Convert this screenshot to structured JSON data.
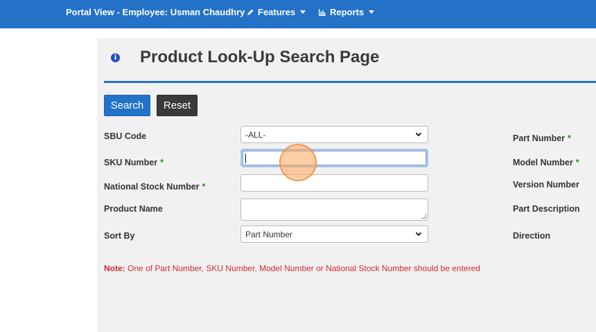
{
  "navbar": {
    "title": "Portal View - Employee: Usman Chaudhry",
    "features_label": "Features",
    "reports_label": "Reports"
  },
  "page": {
    "title": "Product Look-Up Search Page"
  },
  "buttons": {
    "search": "Search",
    "reset": "Reset"
  },
  "form": {
    "sbu_code": {
      "label": "SBU Code",
      "value": "-ALL-"
    },
    "sku_number": {
      "label": "SKU Number",
      "required": "*",
      "value": ""
    },
    "national_stock_number": {
      "label": "National Stock Number",
      "required": "*",
      "value": ""
    },
    "product_name": {
      "label": "Product Name",
      "value": ""
    },
    "sort_by": {
      "label": "Sort By",
      "value": "Part Number"
    },
    "part_number": {
      "label": "Part Number",
      "required": "*"
    },
    "model_number": {
      "label": "Model Number",
      "required": "*"
    },
    "version_number": {
      "label": "Version Number"
    },
    "part_description": {
      "label": "Part Description"
    },
    "direction": {
      "label": "Direction"
    }
  },
  "note": {
    "prefix": "Note:",
    "text": " One of Part Number, SKU Number, Model Number or National Stock Number should be entered"
  },
  "colors": {
    "navbar": "#2472c8",
    "required_marker": "#2e8b2e",
    "note": "#d0282e"
  }
}
